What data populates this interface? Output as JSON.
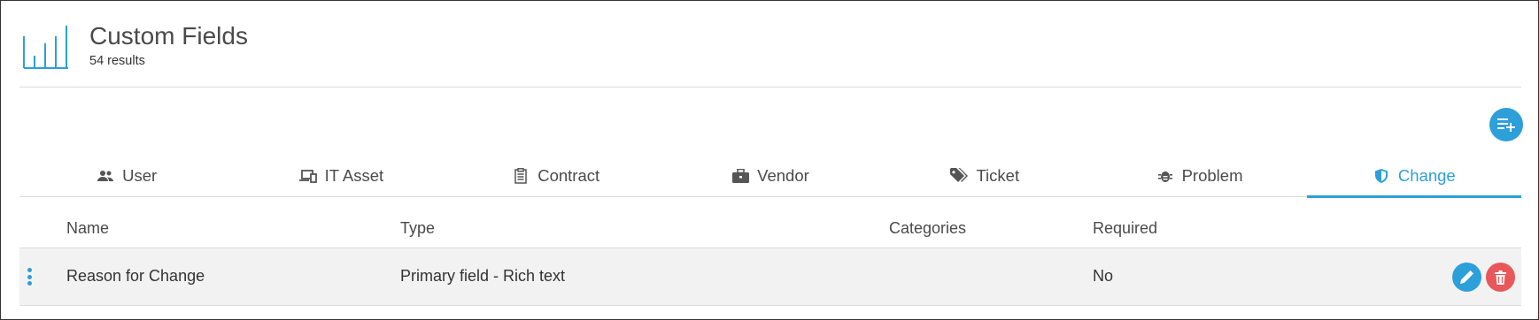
{
  "header": {
    "title": "Custom Fields",
    "subtitle": "54 results",
    "logo_icon": "bar-chart-icon"
  },
  "colors": {
    "accent": "#2d9fd9",
    "danger": "#e8585a",
    "row_bg": "#f2f2f2"
  },
  "tabs": [
    {
      "label": "User",
      "icon": "users-icon"
    },
    {
      "label": "IT Asset",
      "icon": "devices-icon"
    },
    {
      "label": "Contract",
      "icon": "clipboard-icon"
    },
    {
      "label": "Vendor",
      "icon": "briefcase-icon"
    },
    {
      "label": "Ticket",
      "icon": "tags-icon"
    },
    {
      "label": "Problem",
      "icon": "bug-icon"
    },
    {
      "label": "Change",
      "icon": "shield-icon",
      "active": true
    }
  ],
  "table": {
    "columns": [
      "Name",
      "Type",
      "Categories",
      "Required"
    ],
    "rows": [
      {
        "name": "Reason for Change",
        "type": "Primary field - Rich text",
        "categories": "",
        "required": "No"
      }
    ]
  },
  "actions": {
    "add_icon": "playlist-add-icon",
    "edit_icon": "pencil-icon",
    "delete_icon": "trash-icon",
    "drag_icon": "drag-handle-icon"
  }
}
